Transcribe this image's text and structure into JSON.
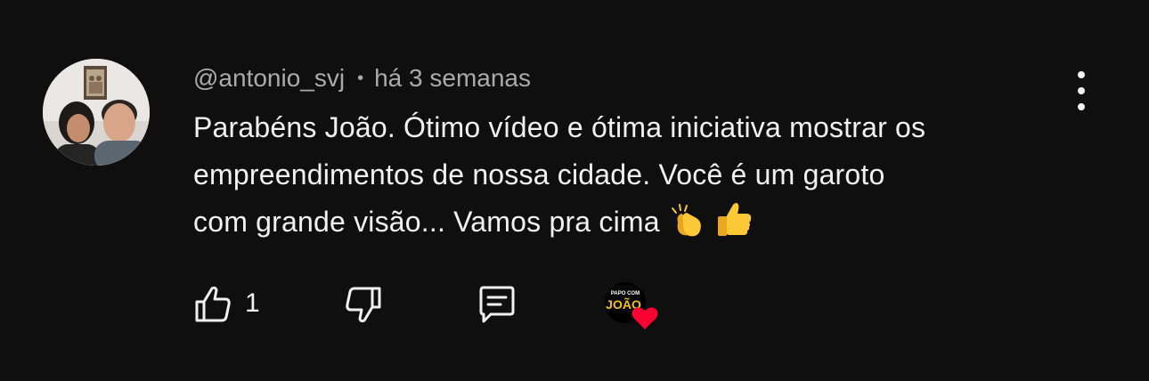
{
  "comment": {
    "author": "@antonio_svj",
    "separator": "•",
    "time": "há 3 semanas",
    "lines": [
      "Parabéns João. Ótimo vídeo e ótima iniciativa mostrar os",
      "empreendimentos de nossa cidade. Você é um garoto",
      "com grande visão... Vamos pra cima"
    ],
    "emojis": [
      "clapping-hands",
      "thumbs-up"
    ]
  },
  "actions": {
    "like_count": "1",
    "icons": {
      "like": "thumbs-up-outline-icon",
      "dislike": "thumbs-down-outline-icon",
      "reply": "reply-comment-icon",
      "more": "more-vertical-icon",
      "creator_heart": "creator-heart-badge"
    }
  },
  "creator_badge": {
    "logo_text_top": "PAPO COM",
    "logo_text_main": "JOÃO"
  },
  "colors": {
    "background": "#0f0f0f",
    "primary_text": "#f1f1f1",
    "secondary_text": "#aaaaaa",
    "heart": "#ff0033",
    "logo_yellow": "#f5c400"
  }
}
